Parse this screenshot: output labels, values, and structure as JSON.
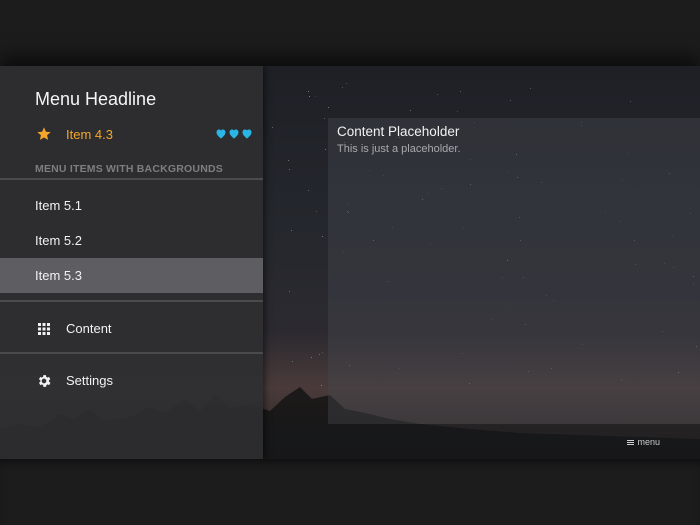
{
  "drawer": {
    "headline": "Menu Headline",
    "featured_item": {
      "label": "Item 4.3",
      "icon": "star-icon",
      "badge_icon": "heart-icon",
      "badge_count": 3,
      "color": "#f4a62a",
      "badge_color": "#29b6e6"
    },
    "section_title": "MENU ITEMS WITH BACKGROUNDS",
    "items": [
      {
        "label": "Item 5.1",
        "active": false
      },
      {
        "label": "Item 5.2",
        "active": false
      },
      {
        "label": "Item 5.3",
        "active": true
      }
    ],
    "nav": [
      {
        "label": "Content",
        "icon": "grid-icon"
      },
      {
        "label": "Settings",
        "icon": "gear-icon"
      }
    ]
  },
  "main": {
    "card_title": "Content Placeholder",
    "card_text": "This is just a placeholder.",
    "menu_toggle": "menu"
  }
}
